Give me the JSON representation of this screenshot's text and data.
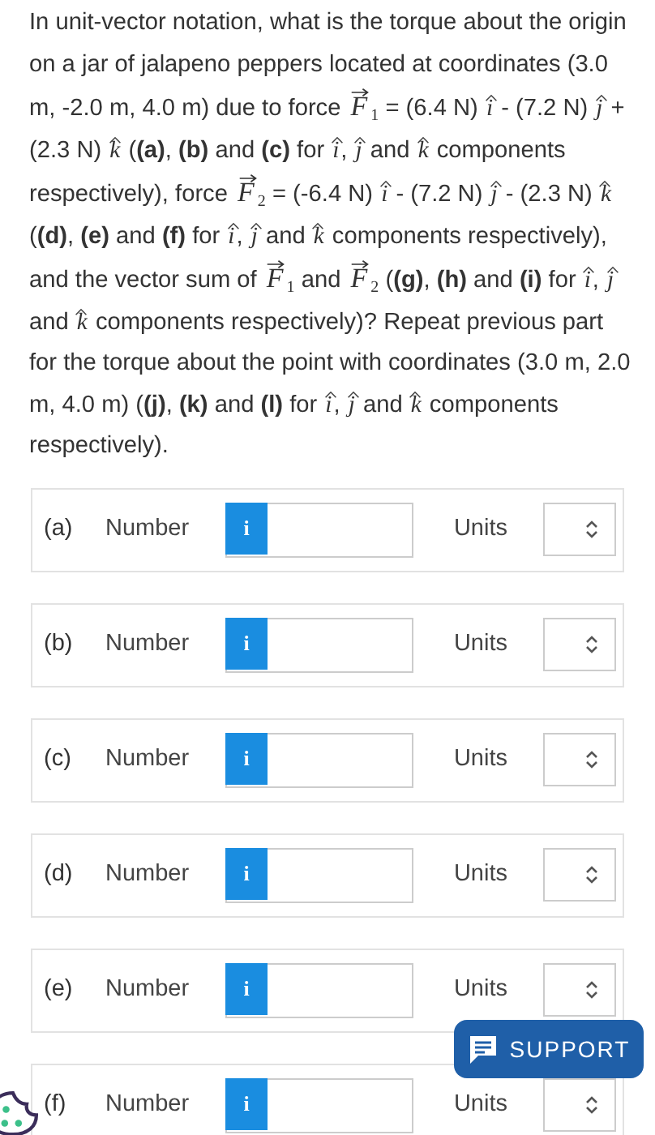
{
  "question": [
    {
      "kind": "text",
      "text": "In unit-vector notation, what is the torque about the origin on a jar of jalapeno peppers located at coordinates (3.0 m, -2.0 m, 4.0 m) due to force "
    },
    {
      "kind": "vector",
      "symbol": "F",
      "sub": "1"
    },
    {
      "kind": "text",
      "text": " = (6.4 N) "
    },
    {
      "kind": "unit",
      "symbol": "i"
    },
    {
      "kind": "text",
      "text": " - (7.2 N) "
    },
    {
      "kind": "unit",
      "symbol": "j"
    },
    {
      "kind": "text",
      "text": " + (2.3 N) "
    },
    {
      "kind": "unit",
      "symbol": "k"
    },
    {
      "kind": "text",
      "text": " (**(a)**, **(b)** and **(c)** for "
    },
    {
      "kind": "unit",
      "symbol": "i"
    },
    {
      "kind": "text",
      "text": ", "
    },
    {
      "kind": "unit",
      "symbol": "j"
    },
    {
      "kind": "text",
      "text": " and "
    },
    {
      "kind": "unit",
      "symbol": "k"
    },
    {
      "kind": "text",
      "text": " components respectively), force "
    },
    {
      "kind": "vector",
      "symbol": "F",
      "sub": "2"
    },
    {
      "kind": "text",
      "text": " = (-6.4 N) "
    },
    {
      "kind": "unit",
      "symbol": "i"
    },
    {
      "kind": "text",
      "text": " - (7.2 N) "
    },
    {
      "kind": "unit",
      "symbol": "j"
    },
    {
      "kind": "text",
      "text": " - (2.3 N) "
    },
    {
      "kind": "unit",
      "symbol": "k"
    },
    {
      "kind": "text",
      "text": " (**(d)**, **(e)** and **(f)** for "
    },
    {
      "kind": "unit",
      "symbol": "i"
    },
    {
      "kind": "text",
      "text": ", "
    },
    {
      "kind": "unit",
      "symbol": "j"
    },
    {
      "kind": "text",
      "text": " and "
    },
    {
      "kind": "unit",
      "symbol": "k"
    },
    {
      "kind": "text",
      "text": " components respectively), and the vector sum of "
    },
    {
      "kind": "vector",
      "symbol": "F",
      "sub": "1"
    },
    {
      "kind": "text",
      "text": " and "
    },
    {
      "kind": "vector",
      "symbol": "F",
      "sub": "2"
    },
    {
      "kind": "text",
      "text": " (**(g)**, **(h)** and **(i)** for "
    },
    {
      "kind": "unit",
      "symbol": "i"
    },
    {
      "kind": "text",
      "text": ", "
    },
    {
      "kind": "unit",
      "symbol": "j"
    },
    {
      "kind": "text",
      "text": " and "
    },
    {
      "kind": "unit",
      "symbol": "k"
    },
    {
      "kind": "text",
      "text": " components respectively)? Repeat previous part for the torque about the point with coordinates (3.0 m, 2.0 m, 4.0 m) (**(j)**, **(k)** and **(l)** for "
    },
    {
      "kind": "unit",
      "symbol": "i"
    },
    {
      "kind": "text",
      "text": ", "
    },
    {
      "kind": "unit",
      "symbol": "j"
    },
    {
      "kind": "text",
      "text": " and "
    },
    {
      "kind": "unit",
      "symbol": "k"
    },
    {
      "kind": "text",
      "text": " components respectively)."
    }
  ],
  "answers": [
    {
      "label": "(a)",
      "field": "Number",
      "info": "i",
      "units": "Units"
    },
    {
      "label": "(b)",
      "field": "Number",
      "info": "i",
      "units": "Units"
    },
    {
      "label": "(c)",
      "field": "Number",
      "info": "i",
      "units": "Units"
    },
    {
      "label": "(d)",
      "field": "Number",
      "info": "i",
      "units": "Units"
    },
    {
      "label": "(e)",
      "field": "Number",
      "info": "i",
      "units": "Units"
    },
    {
      "label": "(f)",
      "field": "Number",
      "info": "i",
      "units": "Units"
    }
  ],
  "support_button": {
    "label": "SUPPORT"
  }
}
